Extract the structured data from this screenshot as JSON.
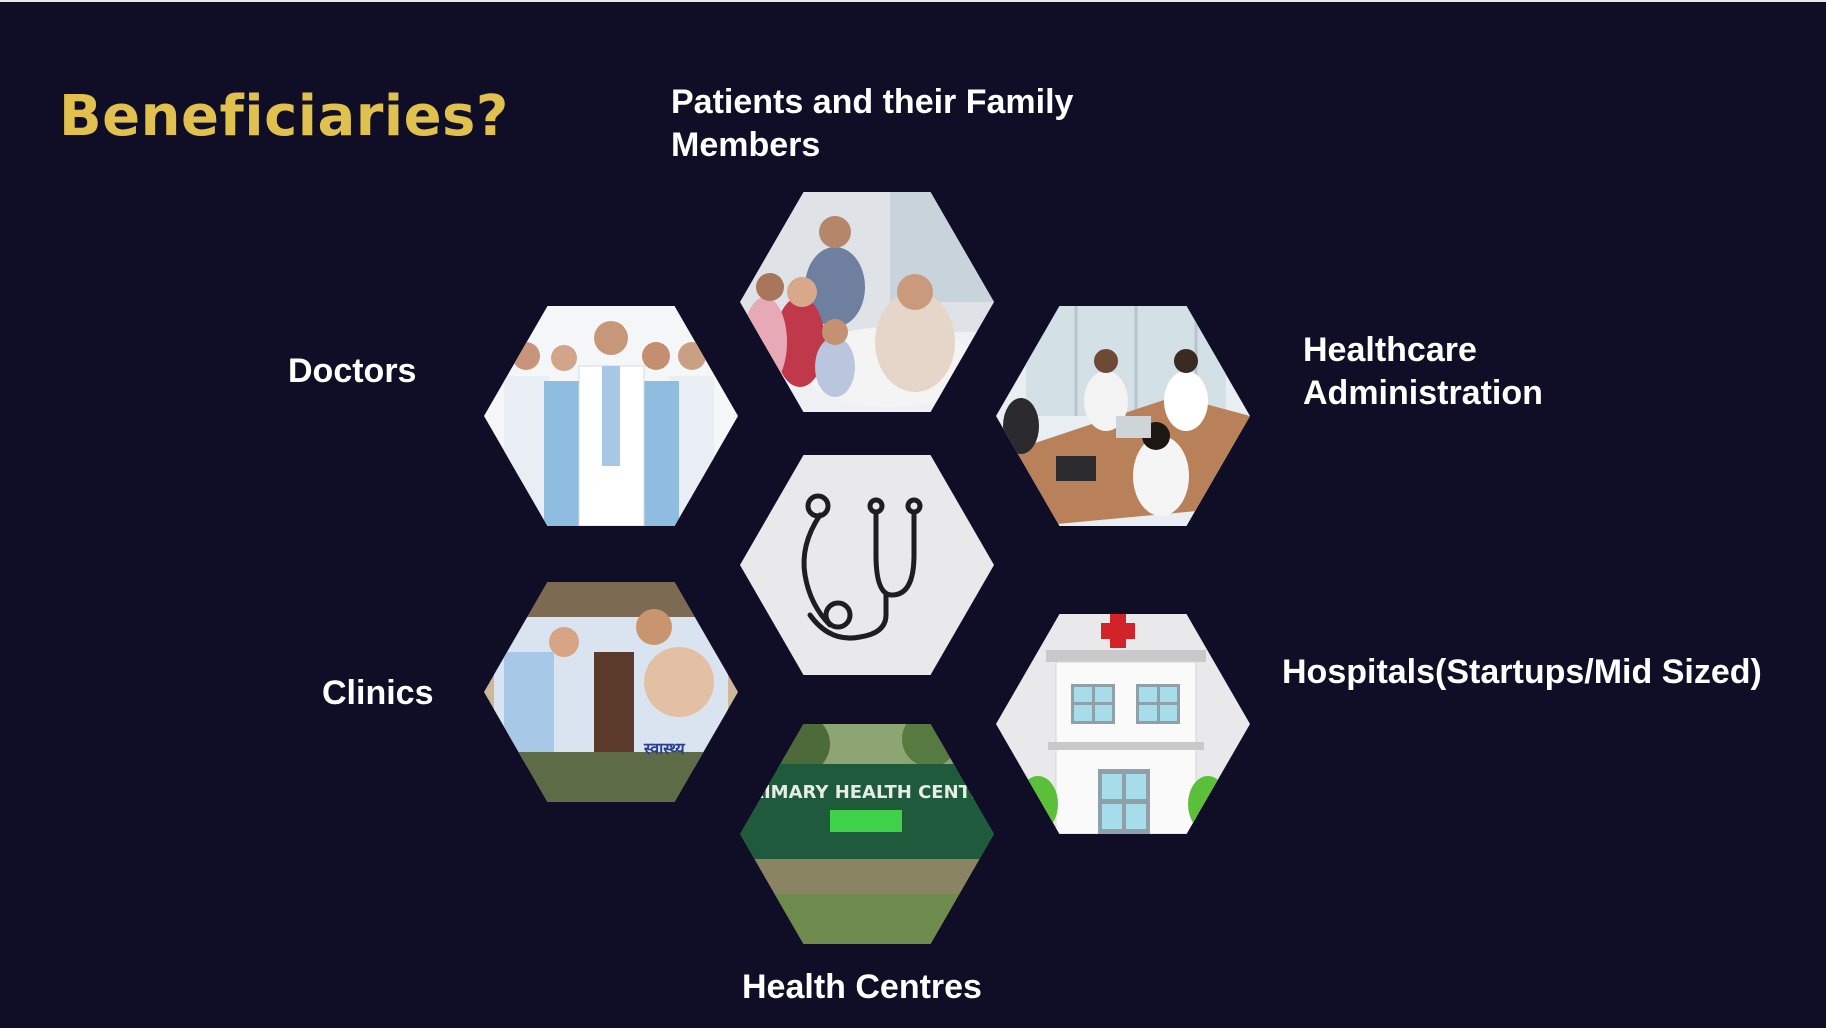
{
  "slide": {
    "title": "Beneficiaries?",
    "labels": {
      "patients_line1": "Patients and their Family",
      "patients_line2": "Members",
      "doctors": "Doctors",
      "admin_line1": "Healthcare",
      "admin_line2": "Administration",
      "clinics": "Clinics",
      "hospitals": "Hospitals(Startups/Mid Sized)",
      "health_centres": "Health Centres"
    },
    "photo_texts": {
      "health_centre_sign": "PRIMARY HEALTH CENTRE",
      "clinic_poster": "स्वास्थ्य"
    }
  },
  "colors": {
    "background": "#100e27",
    "title": "#e0c14e",
    "labels": "#ffffff",
    "hex_light": "#e9e9ec"
  }
}
